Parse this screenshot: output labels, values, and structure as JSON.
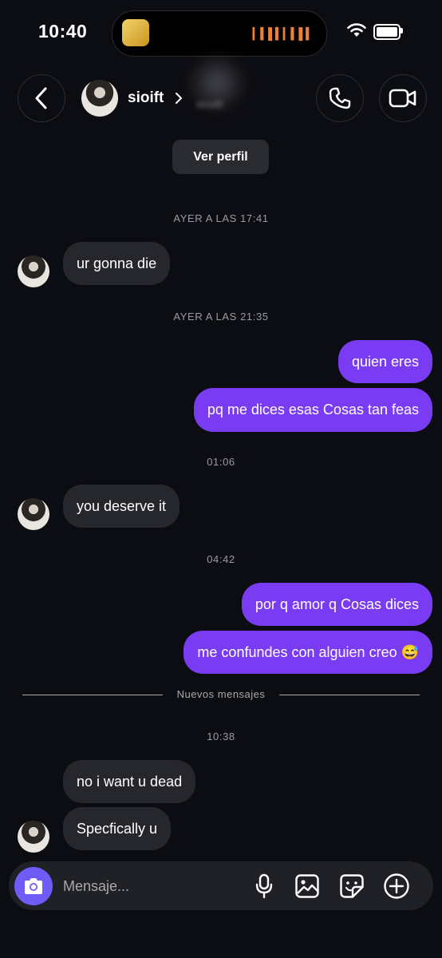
{
  "status_bar": {
    "time": "10:40"
  },
  "header": {
    "username": "sioift",
    "blurred_subtitle": "sioaft"
  },
  "profile_button": {
    "label": "Ver perfil"
  },
  "thread": {
    "stamp_1": "AYER A LAS 17:41",
    "msg_1": "ur gonna die",
    "stamp_2": "AYER A LAS 21:35",
    "msg_2": "quien eres",
    "msg_3": "pq me dices esas Cosas tan feas",
    "stamp_3": "01:06",
    "msg_4": "you deserve it",
    "stamp_4": "04:42",
    "msg_5": "por q amor q Cosas dices",
    "msg_6": "me confundes con alguien creo 😅",
    "new_messages_label": "Nuevos mensajes",
    "stamp_5": "10:38",
    "msg_7": "no i want u dead",
    "msg_8": "Specfically u"
  },
  "composer": {
    "placeholder": "Mensaje..."
  },
  "colors": {
    "outgoing_bubble": "#7a3cf2",
    "incoming_bubble": "#26272c",
    "camera_button": "#6f5cf6",
    "background": "#0c0d12"
  },
  "icons": [
    "back-arrow-icon",
    "chevron-right-icon",
    "phone-icon",
    "video-camera-icon",
    "camera-icon",
    "microphone-icon",
    "gallery-icon",
    "sticker-icon",
    "plus-circle-icon"
  ]
}
